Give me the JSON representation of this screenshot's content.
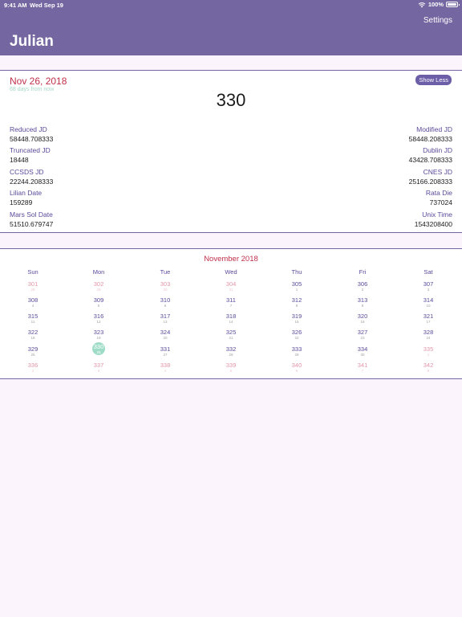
{
  "status": {
    "time": "9:41 AM",
    "date": "Wed Sep 19",
    "battery": "100%"
  },
  "header": {
    "title": "Julian",
    "settings_label": "Settings"
  },
  "summary": {
    "date": "Nov 26, 2018",
    "relative": "68 days from now",
    "day_number": "330",
    "toggle_label": "Show Less"
  },
  "left_fields": [
    {
      "label": "Reduced JD",
      "value": "58448.708333"
    },
    {
      "label": "Truncated JD",
      "value": "18448"
    },
    {
      "label": "CCSDS JD",
      "value": "22244.208333"
    },
    {
      "label": "Lilian Date",
      "value": "159289"
    },
    {
      "label": "Mars Sol Date",
      "value": "51510.679747"
    }
  ],
  "right_fields": [
    {
      "label": "Modified JD",
      "value": "58448.208333"
    },
    {
      "label": "Dublin JD",
      "value": "43428.708333"
    },
    {
      "label": "CNES JD",
      "value": "25166.208333"
    },
    {
      "label": "Rata Die",
      "value": "737024"
    },
    {
      "label": "Unix Time",
      "value": "1543208400"
    }
  ],
  "calendar": {
    "month": "November 2018",
    "weekdays": [
      "Sun",
      "Mon",
      "Tue",
      "Wed",
      "Thu",
      "Fri",
      "Sat"
    ],
    "weeks": [
      [
        {
          "doy": "301",
          "dom": "28",
          "muted": true
        },
        {
          "doy": "302",
          "dom": "29",
          "muted": true
        },
        {
          "doy": "303",
          "dom": "30",
          "muted": true
        },
        {
          "doy": "304",
          "dom": "31",
          "muted": true
        },
        {
          "doy": "305",
          "dom": "1",
          "muted": false
        },
        {
          "doy": "306",
          "dom": "2",
          "muted": false
        },
        {
          "doy": "307",
          "dom": "3",
          "muted": false
        }
      ],
      [
        {
          "doy": "308",
          "dom": "4",
          "muted": false
        },
        {
          "doy": "309",
          "dom": "5",
          "muted": false
        },
        {
          "doy": "310",
          "dom": "6",
          "muted": false
        },
        {
          "doy": "311",
          "dom": "7",
          "muted": false
        },
        {
          "doy": "312",
          "dom": "8",
          "muted": false
        },
        {
          "doy": "313",
          "dom": "9",
          "muted": false
        },
        {
          "doy": "314",
          "dom": "10",
          "muted": false
        }
      ],
      [
        {
          "doy": "315",
          "dom": "11",
          "muted": false
        },
        {
          "doy": "316",
          "dom": "12",
          "muted": false
        },
        {
          "doy": "317",
          "dom": "13",
          "muted": false
        },
        {
          "doy": "318",
          "dom": "14",
          "muted": false
        },
        {
          "doy": "319",
          "dom": "15",
          "muted": false
        },
        {
          "doy": "320",
          "dom": "16",
          "muted": false
        },
        {
          "doy": "321",
          "dom": "17",
          "muted": false
        }
      ],
      [
        {
          "doy": "322",
          "dom": "18",
          "muted": false
        },
        {
          "doy": "323",
          "dom": "19",
          "muted": false
        },
        {
          "doy": "324",
          "dom": "20",
          "muted": false
        },
        {
          "doy": "325",
          "dom": "21",
          "muted": false
        },
        {
          "doy": "326",
          "dom": "22",
          "muted": false
        },
        {
          "doy": "327",
          "dom": "23",
          "muted": false
        },
        {
          "doy": "328",
          "dom": "24",
          "muted": false
        }
      ],
      [
        {
          "doy": "329",
          "dom": "25",
          "muted": false
        },
        {
          "doy": "330",
          "dom": "26",
          "muted": false,
          "selected": true
        },
        {
          "doy": "331",
          "dom": "27",
          "muted": false
        },
        {
          "doy": "332",
          "dom": "28",
          "muted": false
        },
        {
          "doy": "333",
          "dom": "29",
          "muted": false
        },
        {
          "doy": "334",
          "dom": "30",
          "muted": false
        },
        {
          "doy": "335",
          "dom": "1",
          "muted": true
        }
      ],
      [
        {
          "doy": "336",
          "dom": "2",
          "muted": true
        },
        {
          "doy": "337",
          "dom": "3",
          "muted": true
        },
        {
          "doy": "338",
          "dom": "4",
          "muted": true
        },
        {
          "doy": "339",
          "dom": "5",
          "muted": true
        },
        {
          "doy": "340",
          "dom": "6",
          "muted": true
        },
        {
          "doy": "341",
          "dom": "7",
          "muted": true
        },
        {
          "doy": "342",
          "dom": "8",
          "muted": true
        }
      ]
    ]
  },
  "colors": {
    "header": "#7466a0",
    "accent_red": "#c0304a",
    "label_purple": "#5b4a9a",
    "selected_green": "#9fdcc7",
    "background": "#fcf4fc"
  }
}
